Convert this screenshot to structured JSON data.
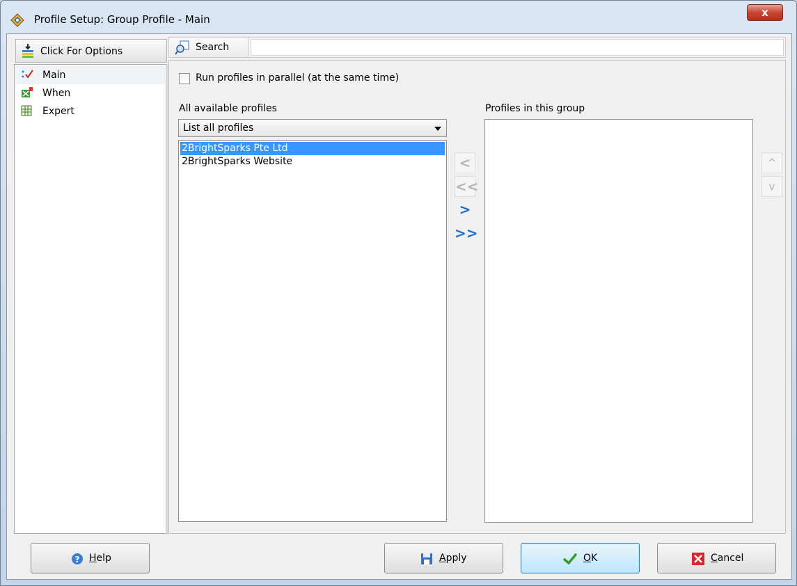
{
  "window": {
    "title": "Profile Setup: Group Profile - Main",
    "close_label": "x"
  },
  "options": {
    "header_label": "Click For Options",
    "items": [
      {
        "label": "Main",
        "icon": "main-check-icon",
        "selected": true
      },
      {
        "label": "When",
        "icon": "when-schedule-icon",
        "selected": false
      },
      {
        "label": "Expert",
        "icon": "expert-grid-icon",
        "selected": false
      }
    ]
  },
  "search": {
    "button_label": "Search",
    "value": ""
  },
  "main": {
    "parallel_checkbox_label": "Run profiles in parallel (at the same time)",
    "parallel_checked": false,
    "available_label": "All available profiles",
    "group_label": "Profiles in this group",
    "filter_selected": "List all profiles",
    "available_profiles": [
      {
        "name": "2BrightSparks Pte Ltd",
        "selected": true
      },
      {
        "name": "2BrightSparks Website",
        "selected": false
      }
    ],
    "group_profiles": [],
    "move_buttons": {
      "remove_one": "<",
      "remove_all": "<<",
      "add_one": ">",
      "add_all": ">>"
    },
    "order_buttons": {
      "up": "^",
      "down": "v"
    }
  },
  "footer": {
    "help_label": "Help",
    "help_mnemonic": "H",
    "apply_label": "Apply",
    "apply_mnemonic": "A",
    "ok_label": "OK",
    "ok_mnemonic": "O",
    "cancel_label": "Cancel",
    "cancel_mnemonic": "C"
  },
  "colors": {
    "selection": "#3399ff",
    "arrow_enabled": "#1f6fc9",
    "arrow_disabled": "#b5b5b5",
    "close_button": "#c94532"
  }
}
